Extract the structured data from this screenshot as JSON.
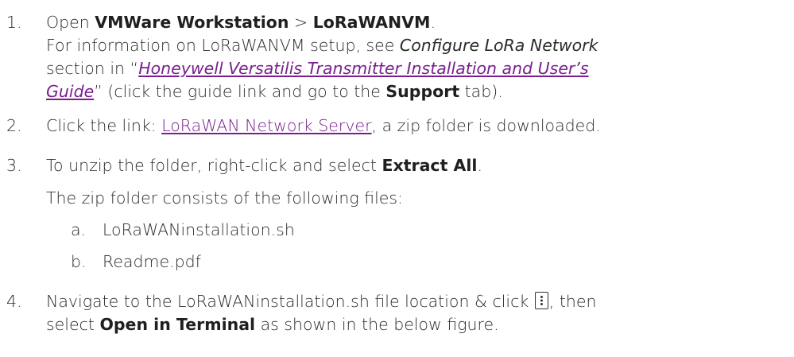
{
  "steps": [
    {
      "number": "1.",
      "line1": {
        "text1": "Open ",
        "bold1": "VMWare Workstation",
        "sep": " > ",
        "bold2": "LoRaWANVM",
        "end": "."
      },
      "line2": {
        "text1": "For information on LoRaWANVM setup, see ",
        "italic": "Configure LoRa Network"
      },
      "line3": {
        "text1": "section in “",
        "link": "Honeywell Versatilis Transmitter Installation and User’s "
      },
      "line4": {
        "link": "Guide",
        "text1": "” (click the guide link and go to the ",
        "bold": "Support",
        "text2": " tab)."
      }
    },
    {
      "number": "2.",
      "line1": {
        "text1": "Click the link: ",
        "link": "LoRaWAN Network Server",
        "text2": ", a zip folder is downloaded."
      }
    },
    {
      "number": "3.",
      "line1": {
        "text1": "To unzip the folder, right-click and select ",
        "bold": "Extract All",
        "end": "."
      },
      "line2": {
        "text1": "The zip folder consists of the following files:"
      },
      "subitems": [
        {
          "letter": "a.",
          "text": "LoRaWANinstallation.sh"
        },
        {
          "letter": "b.",
          "text": "Readme.pdf"
        }
      ]
    },
    {
      "number": "4.",
      "line1": {
        "text1": "Navigate to the LoRaWANinstallation.sh file location & click ",
        "text2": ", then"
      },
      "line2": {
        "text1": "select ",
        "bold": "Open in Terminal",
        "text2": " as shown in the below figure."
      }
    }
  ]
}
